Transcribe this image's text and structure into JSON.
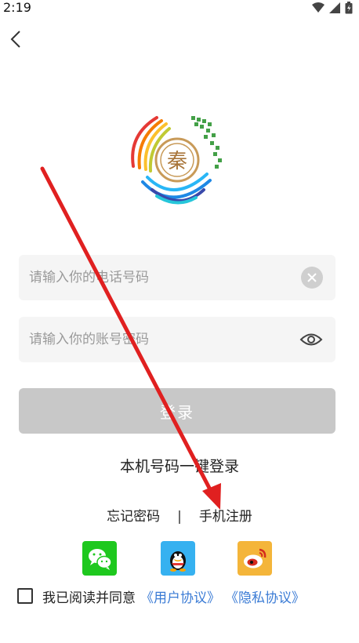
{
  "status_bar": {
    "time": "2:19"
  },
  "nav": {
    "back_icon": "chevron-left-icon"
  },
  "logo": {
    "seal_text": "秦"
  },
  "login_form": {
    "phone_placeholder": "请输入你的电话号码",
    "password_placeholder": "请输入你的账号密码",
    "login_label": "登录"
  },
  "one_click_login": "本机号码一键登录",
  "links": {
    "forgot_password": "忘记密码",
    "separator": "|",
    "register": "手机注册"
  },
  "social_logins": [
    {
      "name": "wechat",
      "icon": "wechat-icon",
      "color": "#1ec81e"
    },
    {
      "name": "qq",
      "icon": "qq-icon",
      "color": "#36b1f0"
    },
    {
      "name": "weibo",
      "icon": "weibo-icon",
      "color": "#f4b53a"
    }
  ],
  "agreement": {
    "text": "我已阅读并同意",
    "user_agreement": "《用户协议》",
    "privacy_agreement": "《隐私协议》",
    "checked": false
  },
  "colors": {
    "link_blue": "#3a7bd5",
    "button_disabled": "#c8c8c8",
    "annotation_arrow": "#e02020"
  }
}
